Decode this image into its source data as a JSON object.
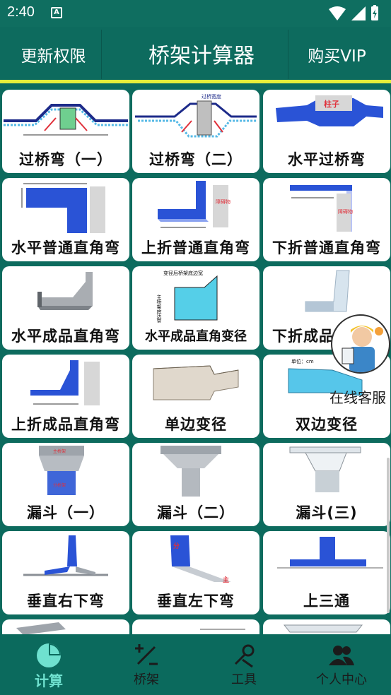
{
  "status_bar": {
    "time": "2:40",
    "notification_icon": "A"
  },
  "header": {
    "left_button": "更新权限",
    "title": "桥架计算器",
    "right_button": "购买VIP"
  },
  "cards": [
    {
      "label": "过桥弯（一）"
    },
    {
      "label": "过桥弯（二）"
    },
    {
      "label": "水平过桥弯"
    },
    {
      "label": "水平普通直角弯"
    },
    {
      "label": "上折普通直角弯"
    },
    {
      "label": "下折普通直角弯"
    },
    {
      "label": "水平成品直角弯"
    },
    {
      "label": "水平成品直角变径"
    },
    {
      "label": "下折成品直角弯"
    },
    {
      "label": "上折成品直角弯"
    },
    {
      "label": "单边变径"
    },
    {
      "label": "双边变径"
    },
    {
      "label": "漏斗（一）"
    },
    {
      "label": "漏斗（二）"
    },
    {
      "label": "漏斗(三)"
    },
    {
      "label": "垂直右下弯"
    },
    {
      "label": "垂直左下弯"
    },
    {
      "label": "上三通"
    }
  ],
  "card_image_text": {
    "c2_top": "过桥宽度",
    "c3_tag": "柱子",
    "c5_tag": "障碍物",
    "c6_tag": "障碍物",
    "c8_top": "变径后桥架底边宽",
    "c8_side": "主桥架底边宽",
    "c12_top": "单位：cm",
    "c13_top": "主桥架",
    "c13_bottom": "分桥架",
    "c16_tag": "分",
    "c16_tag2": "主"
  },
  "chat_float": {
    "label": "在线客服"
  },
  "bottom_nav": [
    {
      "label": "计算",
      "active": true
    },
    {
      "label": "桥架",
      "active": false
    },
    {
      "label": "工具",
      "active": false
    },
    {
      "label": "个人中心",
      "active": false
    }
  ]
}
